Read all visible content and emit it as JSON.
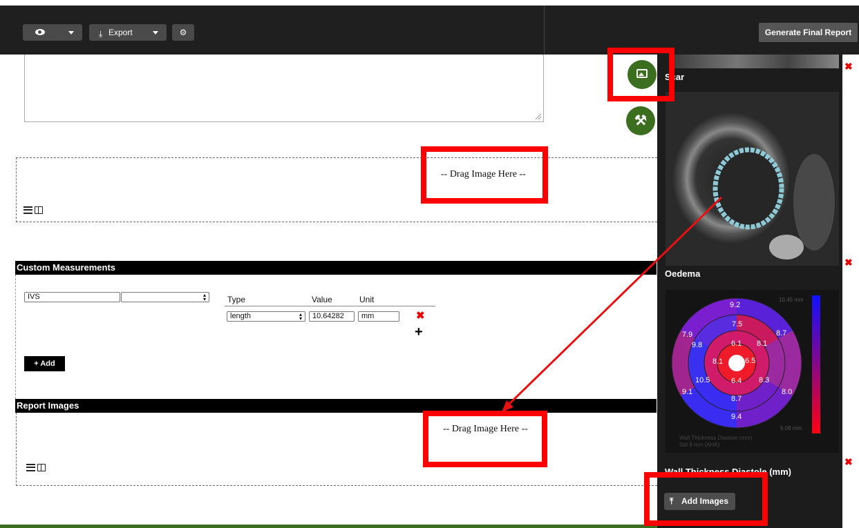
{
  "toolbar": {
    "export_label": "Export",
    "generate_label": "Generate Final Report"
  },
  "dropzone_top": {
    "text": "-- Drag Image Here --"
  },
  "custom_measurements": {
    "title": "Custom Measurements",
    "name_value": "IVS",
    "second_select_value": "",
    "col_type": "Type",
    "col_value": "Value",
    "col_unit": "Unit",
    "type_value": "length",
    "value_value": "10.64282",
    "unit_value": "mm",
    "add_label": "+ Add"
  },
  "report_images": {
    "title": "Report Images",
    "dropzone_text": "-- Drag Image Here --"
  },
  "right_panel": {
    "scar_label": "Scar",
    "oedema_label": "Oedema",
    "wall_label": "Wall Thickness Diastole (mm)",
    "add_images_label": "Add Images",
    "bullseye": {
      "segments": [
        "9.2",
        "7.5",
        "8.7",
        "8.1",
        "6.5",
        "8.3",
        "8.0",
        "9.4",
        "8.7",
        "6.4",
        "10.5",
        "9.1",
        "8.1",
        "6.1",
        "9.8",
        "7.9"
      ],
      "scale_max": "10.45 mm",
      "scale_min": "6.08 mm",
      "caption_line1": "Wall Thickness Diastole (mm)",
      "caption_line2": "Std 8 mm (AHA)"
    }
  },
  "colors": {
    "accent_red": "#ff0000",
    "fab_green": "#3b6e1f",
    "toolbar_dark": "#1f1f1f"
  }
}
